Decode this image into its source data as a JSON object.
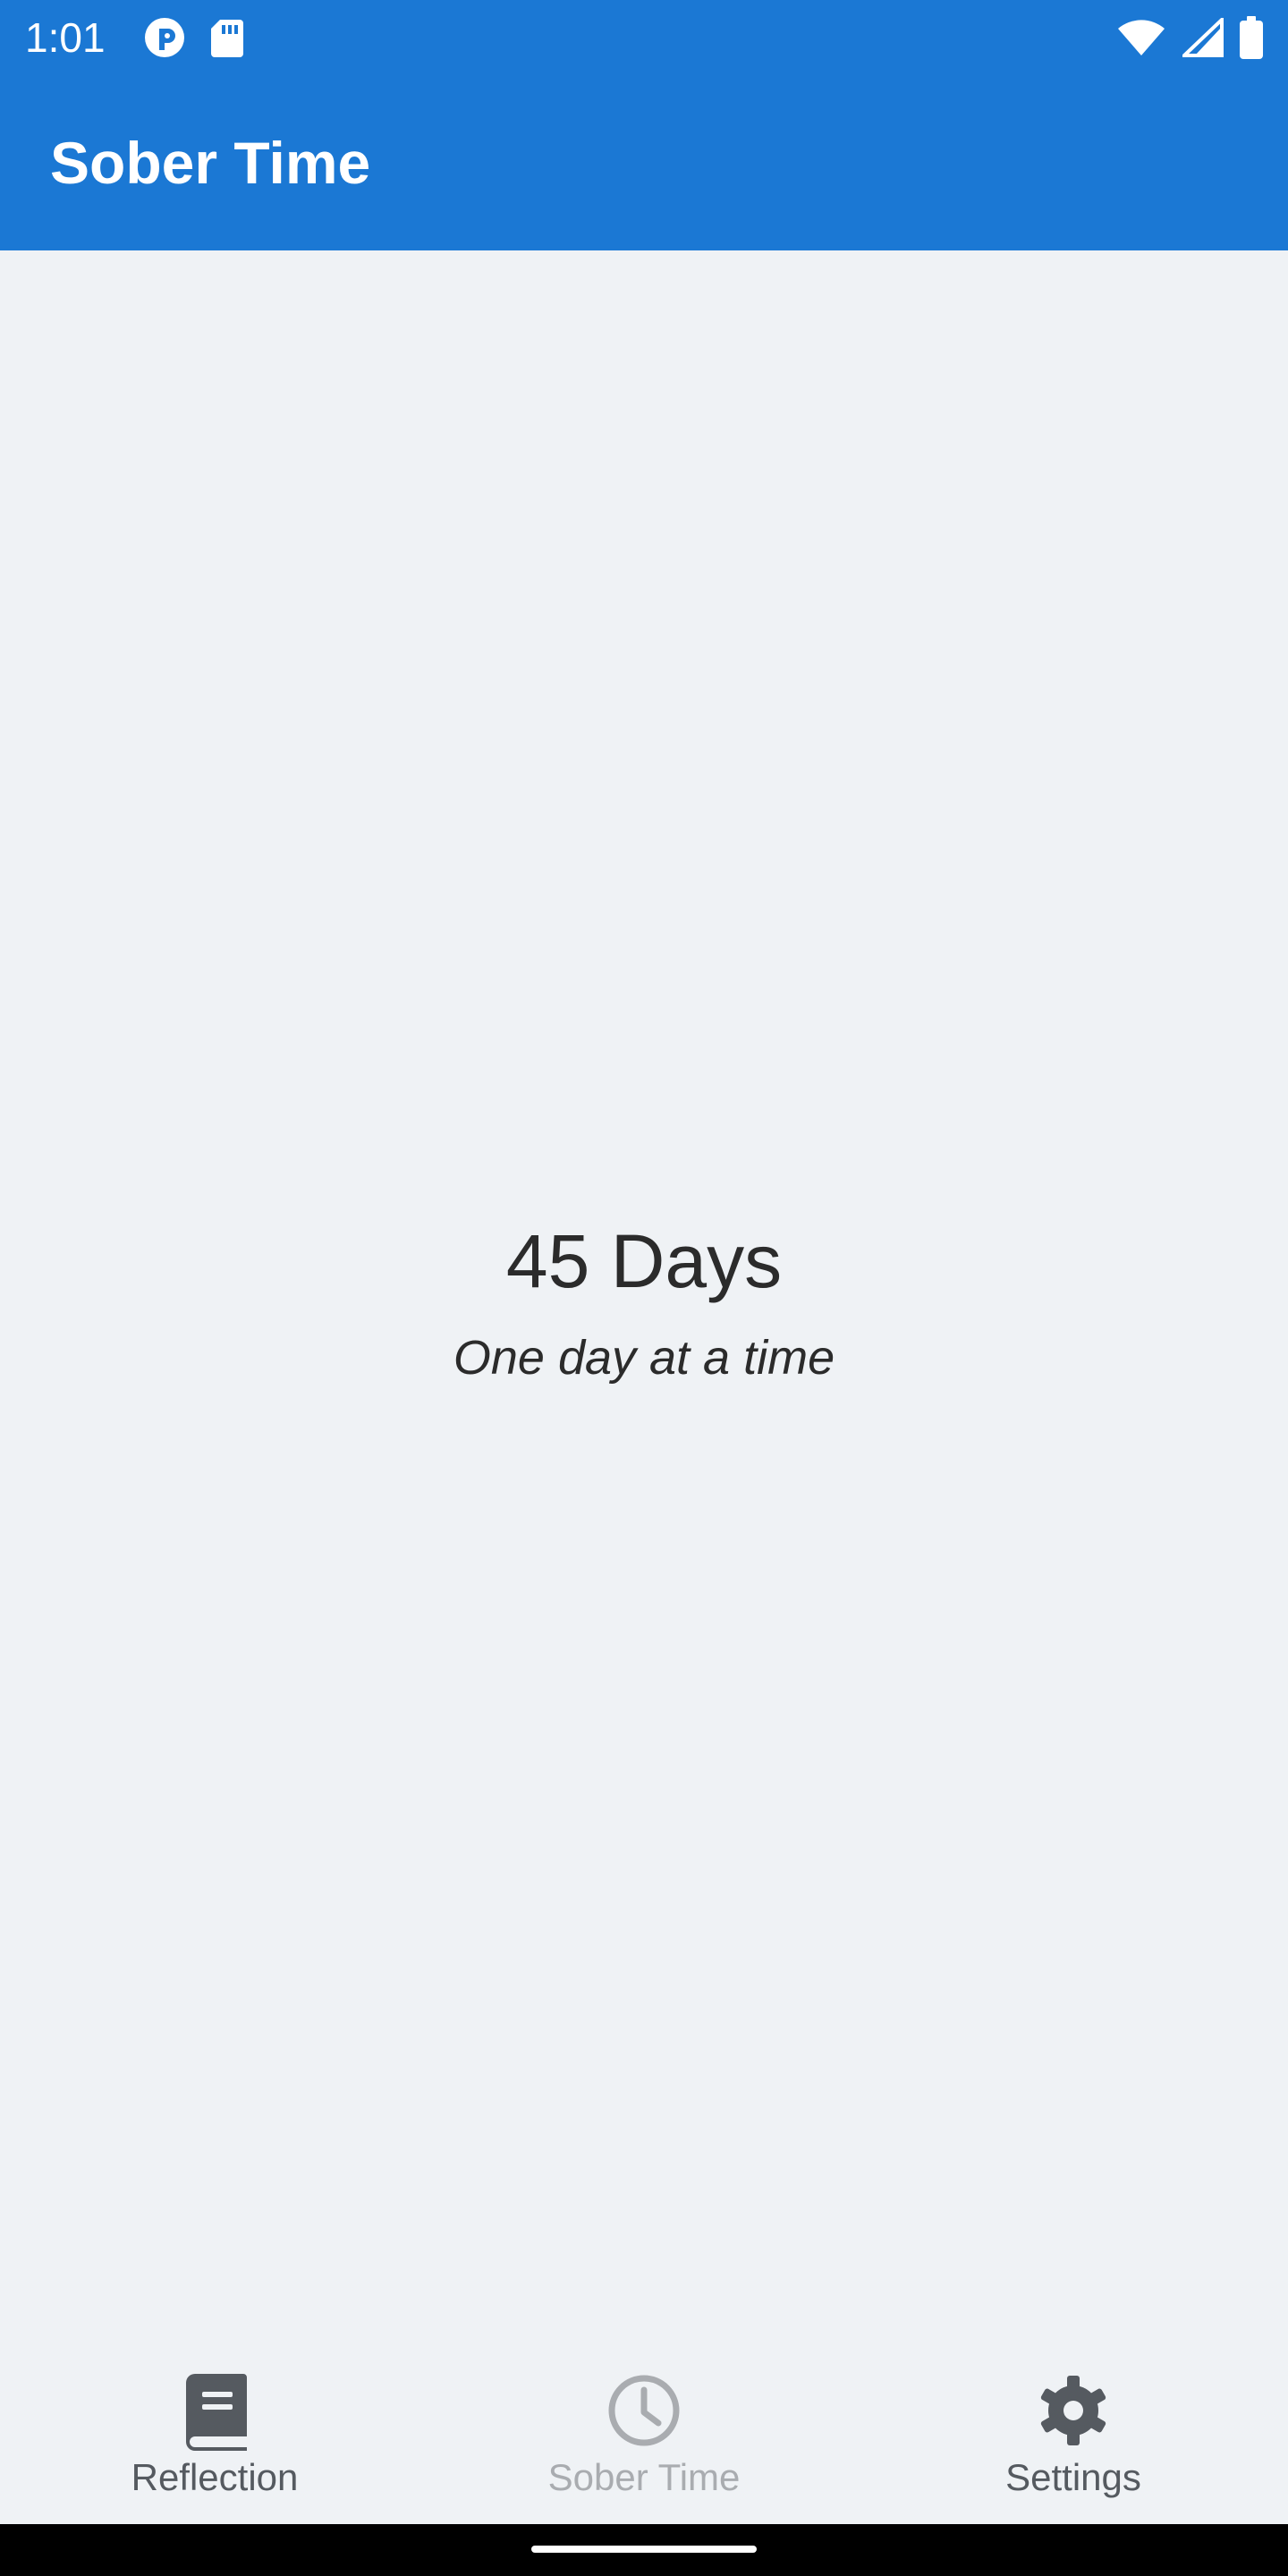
{
  "status_bar": {
    "time": "1:01",
    "icons_left": [
      "tasker-icon",
      "sd-card-icon"
    ],
    "icons_right": [
      "wifi-icon",
      "cell-signal-icon",
      "battery-icon"
    ]
  },
  "app_bar": {
    "title": "Sober Time"
  },
  "main": {
    "counter": "45 Days",
    "motto": "One day at a time"
  },
  "bottom_nav": {
    "items": [
      {
        "label": "Reflection",
        "icon": "book-icon",
        "active": false
      },
      {
        "label": "Sober Time",
        "icon": "clock-icon",
        "active": true
      },
      {
        "label": "Settings",
        "icon": "gear-icon",
        "active": false
      }
    ]
  },
  "colors": {
    "primary": "#1b78d4",
    "background": "#eff2f5",
    "text": "#2b2b2b",
    "nav_inactive": "#555a60",
    "nav_active": "#a9acb0"
  }
}
